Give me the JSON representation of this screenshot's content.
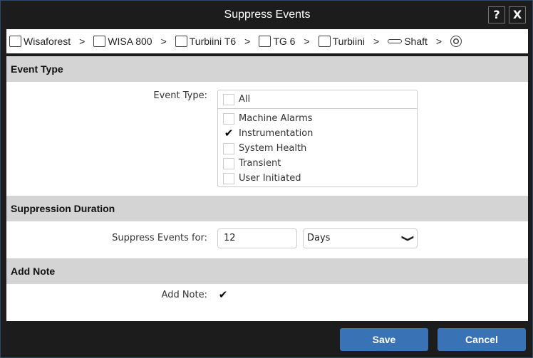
{
  "title": "Suppress Events",
  "help_label": "?",
  "close_label": "X",
  "breadcrumb": [
    {
      "label": "Wisaforest",
      "icon": "factory-icon"
    },
    {
      "label": "WISA 800",
      "icon": "grid-icon"
    },
    {
      "label": "Turbiini T6",
      "icon": "grid-icon"
    },
    {
      "label": "TG 6",
      "icon": "machine-icon"
    },
    {
      "label": "Turbiini",
      "icon": "turbine-icon"
    },
    {
      "label": "Shaft",
      "icon": "shaft-icon"
    },
    {
      "label": "",
      "icon": "bearing-icon"
    }
  ],
  "separator": ">",
  "event_type": {
    "section": "Event Type",
    "label": "Event Type:",
    "all": {
      "label": "All",
      "checked": false
    },
    "options": [
      {
        "label": "Machine Alarms",
        "checked": false
      },
      {
        "label": "Instrumentation",
        "checked": true
      },
      {
        "label": "System Health",
        "checked": false
      },
      {
        "label": "Transient",
        "checked": false
      },
      {
        "label": "User Initiated",
        "checked": false
      }
    ]
  },
  "duration": {
    "section": "Suppression Duration",
    "label": "Suppress Events for:",
    "value": "12",
    "unit": "Days"
  },
  "note": {
    "section": "Add Note",
    "label": "Add Note:",
    "checked": true
  },
  "check_mark": "✔",
  "chevron": "❯",
  "save_label": "Save",
  "cancel_label": "Cancel"
}
